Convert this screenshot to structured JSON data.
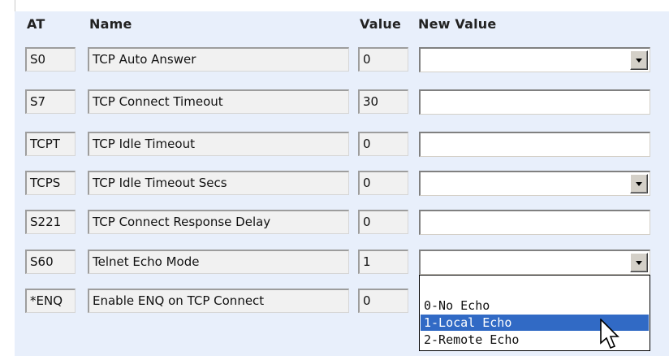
{
  "headers": {
    "at": "AT",
    "name": "Name",
    "value": "Value",
    "new_value": "New Value"
  },
  "rows": [
    {
      "at": "S0",
      "name": "TCP Auto Answer",
      "value": "0",
      "control": "select"
    },
    {
      "at": "S7",
      "name": "TCP Connect Timeout",
      "value": "30",
      "control": "text"
    },
    {
      "at": "TCPT",
      "name": "TCP Idle Timeout",
      "value": "0",
      "control": "text"
    },
    {
      "at": "TCPS",
      "name": "TCP Idle Timeout Secs",
      "value": "0",
      "control": "select"
    },
    {
      "at": "S221",
      "name": "TCP Connect Response Delay",
      "value": "0",
      "control": "text"
    },
    {
      "at": "S60",
      "name": "Telnet Echo Mode",
      "value": "1",
      "control": "select"
    },
    {
      "at": "*ENQ",
      "name": "Enable ENQ on TCP Connect",
      "value": "0",
      "control": "none"
    }
  ],
  "echo_dropdown": {
    "options": [
      "",
      "0-No Echo",
      "1-Local Echo",
      "2-Remote Echo"
    ],
    "highlighted_index": 2
  },
  "icons": {
    "dropdown_arrow": "chevron-down-icon",
    "cursor": "mouse-pointer-icon"
  },
  "colors": {
    "panel": "#e8effb",
    "selection": "#316ac5"
  }
}
